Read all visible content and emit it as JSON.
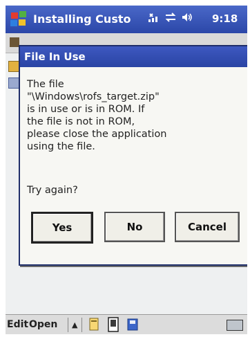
{
  "title_bar": {
    "app_title": "Installing Custo",
    "clock": "9:18",
    "status_icons": [
      "connectivity-icon",
      "sync-arrows-icon",
      "volume-icon"
    ]
  },
  "dialog": {
    "title": "File In Use",
    "message": "The file\n\"\\Windows\\rofs_target.zip\"\nis in use or is in ROM.  If\nthe file is not in ROM,\nplease close the application\nusing the file.",
    "question": "Try again?",
    "buttons": {
      "yes": "Yes",
      "no": "No",
      "cancel": "Cancel"
    }
  },
  "menu_bar": {
    "edit": "Edit",
    "open": "Open",
    "arrow": "▲",
    "icons": [
      "toolbar-doc-icon",
      "toolbar-device-icon",
      "toolbar-save-icon",
      "keyboard-icon"
    ]
  },
  "colors": {
    "titlebar": "#2b47a8",
    "dialog_title": "#2a44a4",
    "dialog_bg": "#f7f7f3"
  }
}
